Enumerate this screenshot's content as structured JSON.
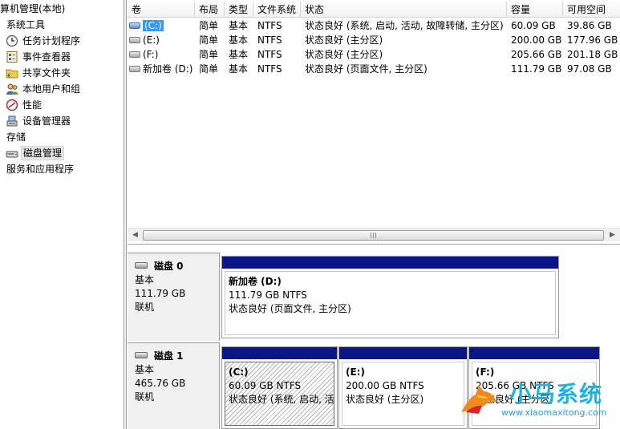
{
  "tree": {
    "root_label": "算机管理(本地)",
    "items": [
      {
        "label": "系统工具",
        "icon": "system-tools-icon",
        "selected": false
      },
      {
        "label": "任务计划程序",
        "icon": "task-scheduler-icon",
        "selected": false
      },
      {
        "label": "事件查看器",
        "icon": "event-viewer-icon",
        "selected": false
      },
      {
        "label": "共享文件夹",
        "icon": "shared-folders-icon",
        "selected": false
      },
      {
        "label": "本地用户和组",
        "icon": "local-users-icon",
        "selected": false
      },
      {
        "label": "性能",
        "icon": "performance-icon",
        "selected": false
      },
      {
        "label": "设备管理器",
        "icon": "device-manager-icon",
        "selected": false
      },
      {
        "label": "存储",
        "icon": "storage-icon",
        "selected": false
      },
      {
        "label": "磁盘管理",
        "icon": "disk-management-icon",
        "selected": true
      },
      {
        "label": "服务和应用程序",
        "icon": "services-icon",
        "selected": false
      }
    ]
  },
  "volume_table": {
    "columns": [
      "卷",
      "布局",
      "类型",
      "文件系统",
      "状态",
      "容量",
      "可用空间"
    ],
    "rows": [
      {
        "volume": "(C:)",
        "layout": "简单",
        "type": "基本",
        "fs": "NTFS",
        "status": "状态良好 (系统, 启动, 活动, 故障转储, 主分区)",
        "capacity": "60.09 GB",
        "free": "39.86 GB",
        "selected": true
      },
      {
        "volume": "(E:)",
        "layout": "简单",
        "type": "基本",
        "fs": "NTFS",
        "status": "状态良好 (主分区)",
        "capacity": "200.00 GB",
        "free": "177.96 GB",
        "selected": false
      },
      {
        "volume": "(F:)",
        "layout": "简单",
        "type": "基本",
        "fs": "NTFS",
        "status": "状态良好 (主分区)",
        "capacity": "205.66 GB",
        "free": "201.18 GB",
        "selected": false
      },
      {
        "volume": "新加卷 (D:)",
        "layout": "简单",
        "type": "基本",
        "fs": "NTFS",
        "status": "状态良好 (页面文件, 主分区)",
        "capacity": "111.79 GB",
        "free": "97.08 GB",
        "selected": false
      }
    ]
  },
  "disks": [
    {
      "name": "磁盘 0",
      "type": "基本",
      "size": "111.79 GB",
      "state": "联机",
      "partitions": [
        {
          "name": "新加卷 (D:)",
          "size_fs": "111.79 GB NTFS",
          "status": "状态良好 (页面文件, 主分区)"
        }
      ]
    },
    {
      "name": "磁盘 1",
      "type": "基本",
      "size": "465.76 GB",
      "state": "联机",
      "partitions": [
        {
          "name": "(C:)",
          "size_fs": "60.09 GB NTFS",
          "status": "状态良好 (系统, 启动, 活"
        },
        {
          "name": "(E:)",
          "size_fs": "200.00 GB NTFS",
          "status": "状态良好 (主分区)"
        },
        {
          "name": "(F:)",
          "size_fs": "205.66 GB NTFS",
          "status": "状态良好 (主分区)"
        }
      ]
    }
  ],
  "watermark": {
    "brand": "小马系统",
    "url": "www.xiaomaxitong.com"
  },
  "colors": {
    "partition_bar": "#0b1488",
    "selection": "#3399ff",
    "watermark": "#19b3e8"
  }
}
